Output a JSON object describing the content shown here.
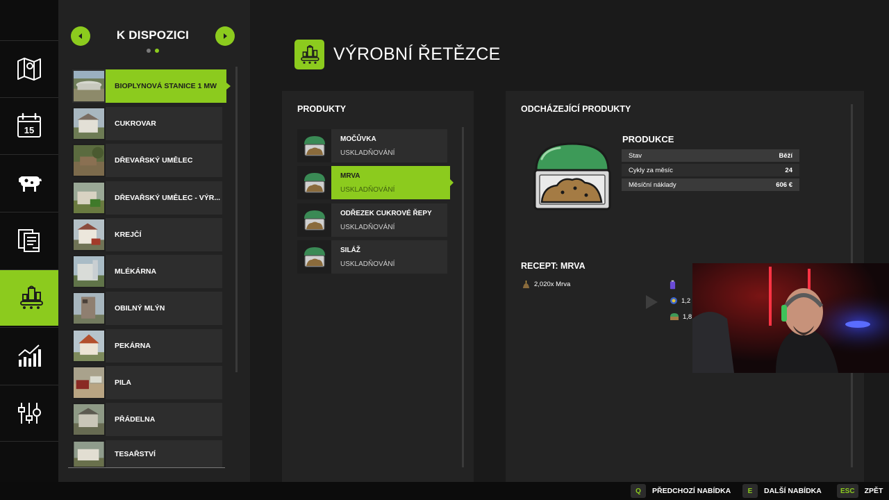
{
  "navigation": {
    "icons": [
      "map-icon",
      "calendar-icon",
      "animals-icon",
      "contracts-icon",
      "production-icon",
      "statistics-icon",
      "settings-icon"
    ],
    "calendar_day": "15",
    "active": "production-icon"
  },
  "list": {
    "title": "K DISPOZICI",
    "page_dots": 2,
    "active_dot": 2,
    "items": [
      {
        "label": "BIOPLYNOVÁ STANICE 1 MW",
        "active": true
      },
      {
        "label": "CUKROVAR"
      },
      {
        "label": "DŘEVAŘSKÝ UMĚLEC"
      },
      {
        "label": "DŘEVAŘSKÝ UMĚLEC - VÝR..."
      },
      {
        "label": "KREJČÍ"
      },
      {
        "label": "MLÉKÁRNA"
      },
      {
        "label": "OBILNÝ MLÝN"
      },
      {
        "label": "PEKÁRNA"
      },
      {
        "label": "PILA"
      },
      {
        "label": "PŘÁDELNA"
      },
      {
        "label": "TESAŘSTVÍ"
      }
    ]
  },
  "page": {
    "title": "VÝROBNÍ ŘETĚZCE"
  },
  "products_panel": {
    "title": "PRODUKTY",
    "items": [
      {
        "name": "MOČŮVKA",
        "status": "USKLADŇOVÁNÍ"
      },
      {
        "name": "MRVA",
        "status": "USKLADŇOVÁNÍ",
        "active": true
      },
      {
        "name": "ODŘEZEK CUKROVÉ ŘEPY",
        "status": "USKLADŇOVÁNÍ"
      },
      {
        "name": "SILÁŽ",
        "status": "USKLADŇOVÁNÍ"
      }
    ]
  },
  "outgoing_panel": {
    "title": "ODCHÁZEJÍCÍ PRODUKTY",
    "production": {
      "title": "PRODUKCE",
      "rows": [
        {
          "label": "Stav",
          "value": "Běží"
        },
        {
          "label": "Cykly za měsíc",
          "value": "24"
        },
        {
          "label": "Měsíční náklady",
          "value": "606 €"
        }
      ]
    },
    "recipe": {
      "title": "RECEPT: MRVA",
      "input": "2,020x Mrva",
      "outputs": [
        "1,2",
        "1,8"
      ]
    }
  },
  "hints": [
    {
      "key": "Q",
      "label": "PŘEDCHOZÍ NABÍDKA"
    },
    {
      "key": "E",
      "label": "DALŠÍ NABÍDKA"
    },
    {
      "key": "ESC",
      "label": "ZPĚT"
    }
  ],
  "colors": {
    "accent": "#8ccb1e",
    "background": "#1a1a1a",
    "panel": "#232323",
    "row": "#2d2d2d"
  }
}
